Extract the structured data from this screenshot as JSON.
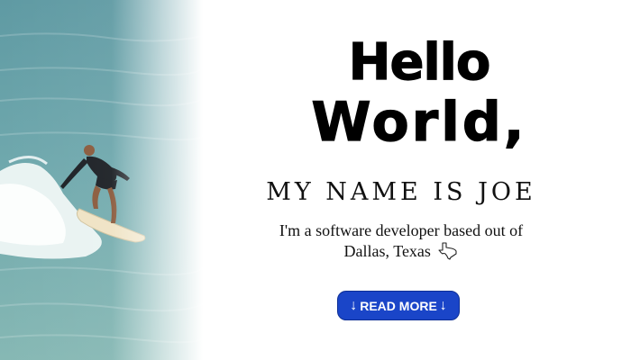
{
  "hero": {
    "photo_subject": "surfer riding a wave",
    "headline_line1": "Hello",
    "headline_line2": "World,",
    "subtitle": "MY NAME IS JOE",
    "bio_line1": "I'm a software developer based out of",
    "bio_line2": "Dallas, Texas",
    "bio_icon": "texas-outline-icon",
    "button": {
      "label": "READ MORE",
      "left_icon": "arrow-down-icon",
      "right_icon": "arrow-down-icon",
      "left_glyph": "↓",
      "right_glyph": "↓",
      "color": "#1a45c8"
    }
  }
}
